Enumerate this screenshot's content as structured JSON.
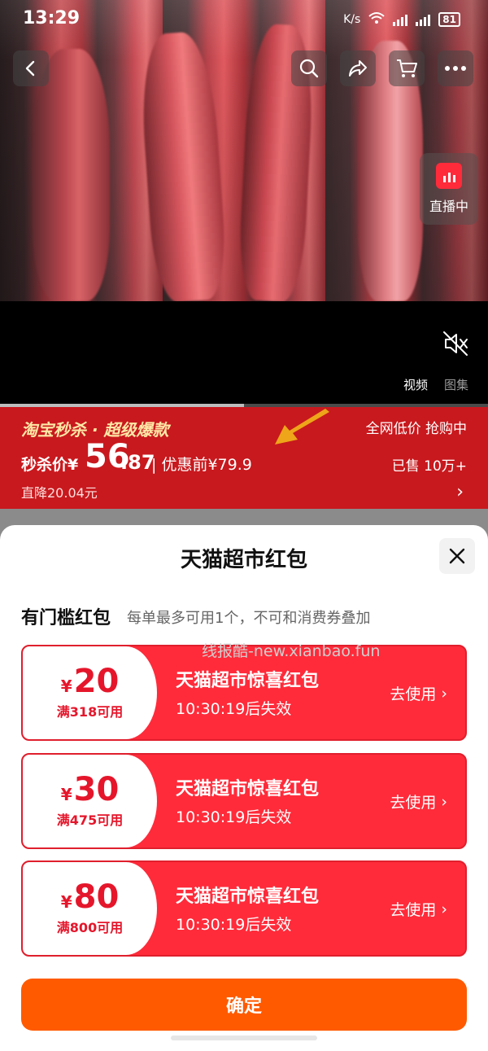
{
  "status_bar": {
    "time": "13:29",
    "speed": "K/s",
    "battery": "81"
  },
  "video": {
    "live_label": "直播中",
    "tabs": [
      "视频",
      "图集"
    ],
    "progress": 0.5
  },
  "promo": {
    "brand": "淘宝秒杀 · 超级爆款",
    "tagline": "全网低价 抢购中",
    "price_label": "秒杀价¥",
    "price_int": "56",
    "price_dec": ".87",
    "original": "| 优惠前¥79.9",
    "sold": "已售 10万+",
    "drop": "直降20.04元"
  },
  "sheet": {
    "title": "天猫超市红包",
    "section_title": "有门槛红包",
    "section_sub": "每单最多可用1个，不可和消费券叠加",
    "watermark": "线报酷-new.xianbao.fun",
    "coupons": [
      {
        "currency": "¥",
        "amount": "20",
        "condition": "满318可用",
        "name": "天猫超市惊喜红包",
        "expiry": "10:30:19后失效",
        "action": "去使用"
      },
      {
        "currency": "¥",
        "amount": "30",
        "condition": "满475可用",
        "name": "天猫超市惊喜红包",
        "expiry": "10:30:19后失效",
        "action": "去使用"
      },
      {
        "currency": "¥",
        "amount": "80",
        "condition": "满800可用",
        "name": "天猫超市惊喜红包",
        "expiry": "10:30:19后失效",
        "action": "去使用"
      }
    ],
    "confirm_label": "确定"
  },
  "colors": {
    "coupon_red": "#ff2b3a",
    "confirm_orange": "#ff5a00",
    "promo_red": "#c8191e"
  }
}
